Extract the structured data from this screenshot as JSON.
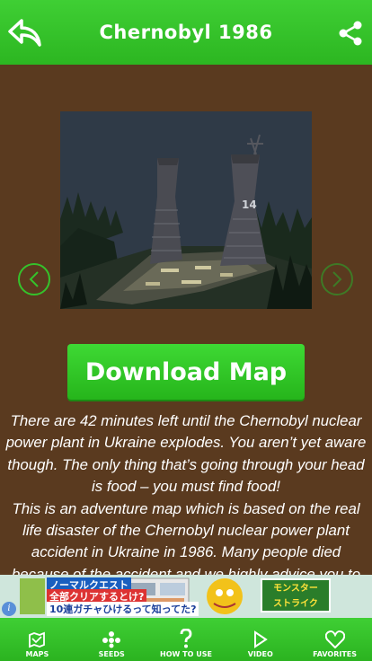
{
  "header": {
    "title": "Chernobyl 1986"
  },
  "download_label": "Download Map",
  "description": [
    "There are 42 minutes left until the Chernobyl nuclear power plant in Ukraine explodes. You aren’t yet aware though. The only thing that’s going through your head is food – you must find food!",
    "This is an adventure map which is based on the real life disaster of the Chernobyl nuclear power plant accident in Ukraine in 1986. Many people died because of the accident and we highly advice you to"
  ],
  "screenshot": {
    "tower_number": "14"
  },
  "ad": {
    "line1": "ノーマルクエスト",
    "line2": "全部クリアするとけ?",
    "line3": "10連ガチャひけるって知ってた?",
    "logo_line1": "モンスター",
    "logo_line2": "ストライク",
    "info": "i"
  },
  "tabs": [
    {
      "label": "MAPS",
      "icon": "map-icon"
    },
    {
      "label": "SEEDS",
      "icon": "seeds-icon"
    },
    {
      "label": "HOW TO USE",
      "icon": "question-icon"
    },
    {
      "label": "VIDEO",
      "icon": "play-icon"
    },
    {
      "label": "FAVORITES",
      "icon": "heart-icon"
    }
  ],
  "colors": {
    "brand_green": "#35c22b",
    "background_brown": "#5a3a1f"
  }
}
